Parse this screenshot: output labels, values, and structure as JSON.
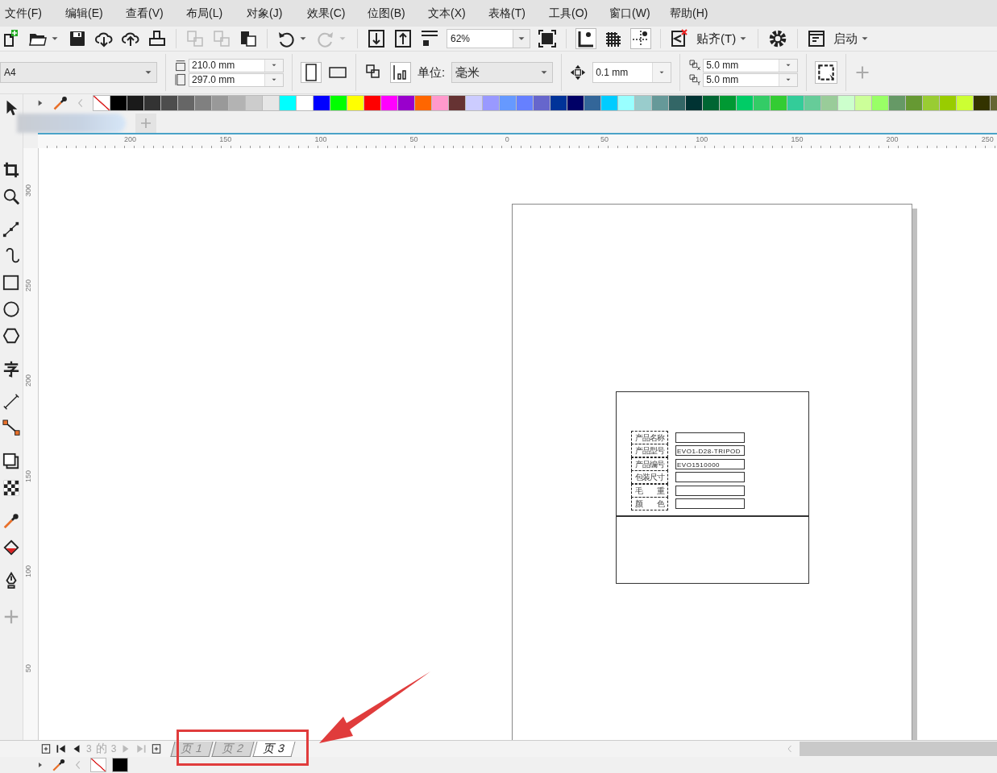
{
  "menu": [
    {
      "label": "文件(F)"
    },
    {
      "label": "编辑(E)"
    },
    {
      "label": "查看(V)"
    },
    {
      "label": "布局(L)"
    },
    {
      "label": "对象(J)"
    },
    {
      "label": "效果(C)"
    },
    {
      "label": "位图(B)"
    },
    {
      "label": "文本(X)"
    },
    {
      "label": "表格(T)"
    },
    {
      "label": "工具(O)"
    },
    {
      "label": "窗口(W)"
    },
    {
      "label": "帮助(H)"
    }
  ],
  "toolbar": {
    "zoom": "62%",
    "snap": "贴齐(T)",
    "launch": "启动"
  },
  "property_bar": {
    "page_size": "A4",
    "width": "210.0 mm",
    "height": "297.0 mm",
    "units_label": "单位:",
    "units": "毫米",
    "nudge": "0.1 mm",
    "duplicate_x": "5.0 mm",
    "duplicate_y": "5.0 mm"
  },
  "palette": [
    {
      "color": "#000000"
    },
    {
      "color": "#1a1a1a"
    },
    {
      "color": "#333333"
    },
    {
      "color": "#4d4d4d"
    },
    {
      "color": "#666666"
    },
    {
      "color": "#808080"
    },
    {
      "color": "#999999"
    },
    {
      "color": "#b3b3b3"
    },
    {
      "color": "#cccccc"
    },
    {
      "color": "#e6e6e6"
    },
    {
      "color": "#00ffff"
    },
    {
      "color": "#ffffff"
    },
    {
      "color": "#0000ff"
    },
    {
      "color": "#00ff00"
    },
    {
      "color": "#ffff00"
    },
    {
      "color": "#ff0000"
    },
    {
      "color": "#ff00ff"
    },
    {
      "color": "#9900cc"
    },
    {
      "color": "#ff6600"
    },
    {
      "color": "#ff99cc"
    },
    {
      "color": "#663333"
    },
    {
      "color": "#ccccff"
    },
    {
      "color": "#9999ff"
    },
    {
      "color": "#6699ff"
    },
    {
      "color": "#6680ff"
    },
    {
      "color": "#6666cc"
    },
    {
      "color": "#003399"
    },
    {
      "color": "#000066"
    },
    {
      "color": "#336699"
    },
    {
      "color": "#00ccff"
    },
    {
      "color": "#99ffff"
    },
    {
      "color": "#99cccc"
    },
    {
      "color": "#669999"
    },
    {
      "color": "#336666"
    },
    {
      "color": "#003333"
    },
    {
      "color": "#006633"
    },
    {
      "color": "#009933"
    },
    {
      "color": "#00cc66"
    },
    {
      "color": "#33cc66"
    },
    {
      "color": "#33cc33"
    },
    {
      "color": "#33cc99"
    },
    {
      "color": "#66cc99"
    },
    {
      "color": "#99cc99"
    },
    {
      "color": "#ccffcc"
    },
    {
      "color": "#ccff99"
    },
    {
      "color": "#99ff66"
    },
    {
      "color": "#669966"
    },
    {
      "color": "#669933"
    },
    {
      "color": "#99cc33"
    },
    {
      "color": "#99cc00"
    },
    {
      "color": "#ccff33"
    },
    {
      "color": "#333300"
    },
    {
      "color": "#666633"
    }
  ],
  "ruler": {
    "horizontal": [
      "200",
      "150",
      "100",
      "50",
      "0",
      "50",
      "100",
      "150",
      "200",
      "250"
    ],
    "vertical": [
      "300",
      "250",
      "200",
      "150",
      "100",
      "50"
    ]
  },
  "label_card": {
    "rows": [
      {
        "label": "产品名称",
        "value": ""
      },
      {
        "label": "产品型号",
        "value": "EVO1-D28-TRIPOD"
      },
      {
        "label": "产品编号",
        "value": "EVO1510000"
      },
      {
        "label": "包装尺寸",
        "value": ""
      },
      {
        "label": "毛　　重",
        "value": ""
      },
      {
        "label": "颜　　色",
        "value": ""
      }
    ]
  },
  "page_nav": {
    "current": "3",
    "of": "的",
    "total": "3",
    "tabs": [
      {
        "label": "页 1",
        "selected": false
      },
      {
        "label": "页 2",
        "selected": false
      },
      {
        "label": "页 3",
        "selected": true
      }
    ]
  },
  "document_palette": [
    {
      "color": "#000000"
    }
  ],
  "highlight_frame": {
    "color": "#e03c3c"
  },
  "arrow": {
    "color": "#e03c3c"
  }
}
